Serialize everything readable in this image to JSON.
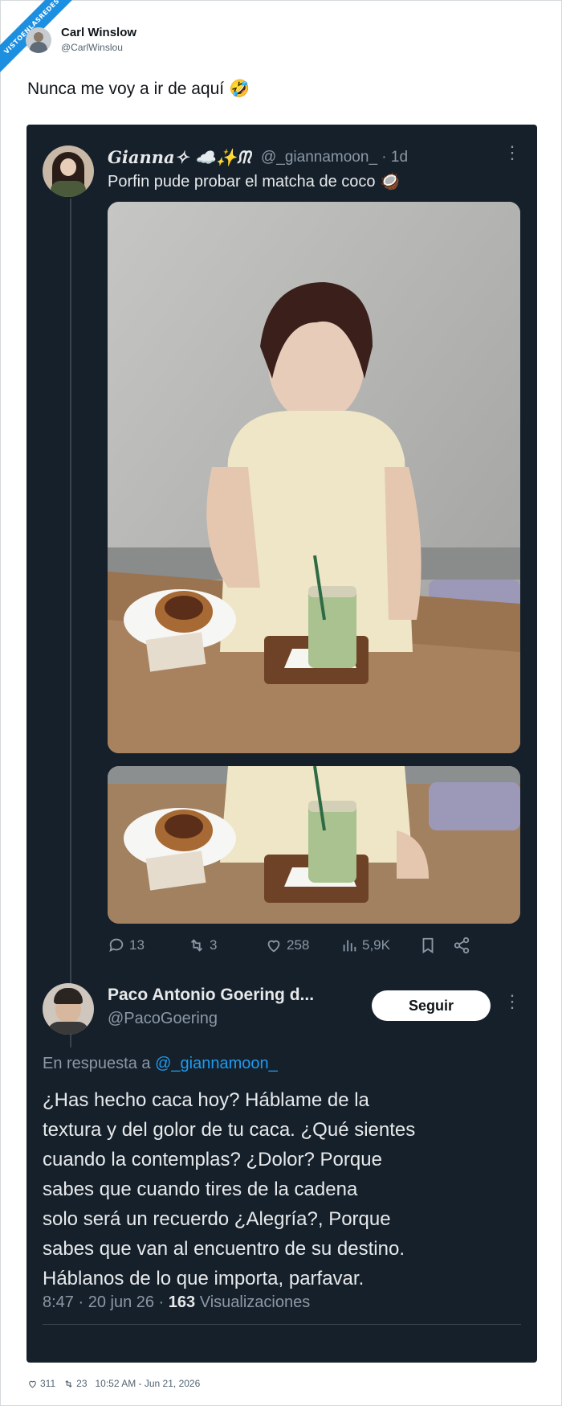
{
  "badge": {
    "text": "VISTOENLASREDES"
  },
  "top_tweet": {
    "author_name": "Carl Winslow",
    "author_handle": "@CarlWinslou",
    "text": "Nunca me voy a ir de aquí 🤣",
    "likes": "311",
    "retweets": "23",
    "timestamp": "10:52 AM - Jun 21, 2026"
  },
  "quoted_tweet": {
    "author_name": "Gianna✧ ☁️✨ᙏ",
    "author_handle": "@_giannamoon_ · 1d",
    "text": "Porfin pude probar el matcha de coco 🥥",
    "more": "⋮",
    "actions": {
      "replies": "13",
      "retweets": "3",
      "likes": "258",
      "views": "5,9K"
    }
  },
  "reply_tweet": {
    "author_name": "Paco Antonio Goering d...",
    "author_handle": "@PacoGoering",
    "follow_label": "Seguir",
    "more": "⋮",
    "reply_prefix": "En respuesta a ",
    "reply_mention": "@_giannamoon_",
    "body": "¿Has hecho caca hoy? Háblame de la\ntextura y del golor de tu caca. ¿Qué sientes\ncuando la contemplas? ¿Dolor? Porque\nsabes que cuando tires de la cadena\nsolo será un recuerdo ¿Alegría?, Porque\nsabes que van al encuentro de su destino.\nHáblanos de lo que importa, parfavar.",
    "meta_time": "8:47 · 20 jun 26 · ",
    "meta_views": "163",
    "meta_views_label": " Visualizaciones"
  },
  "colors": {
    "dark_bg": "#15202b",
    "link_blue": "#1d9bf0",
    "muted": "#8b98a5"
  }
}
